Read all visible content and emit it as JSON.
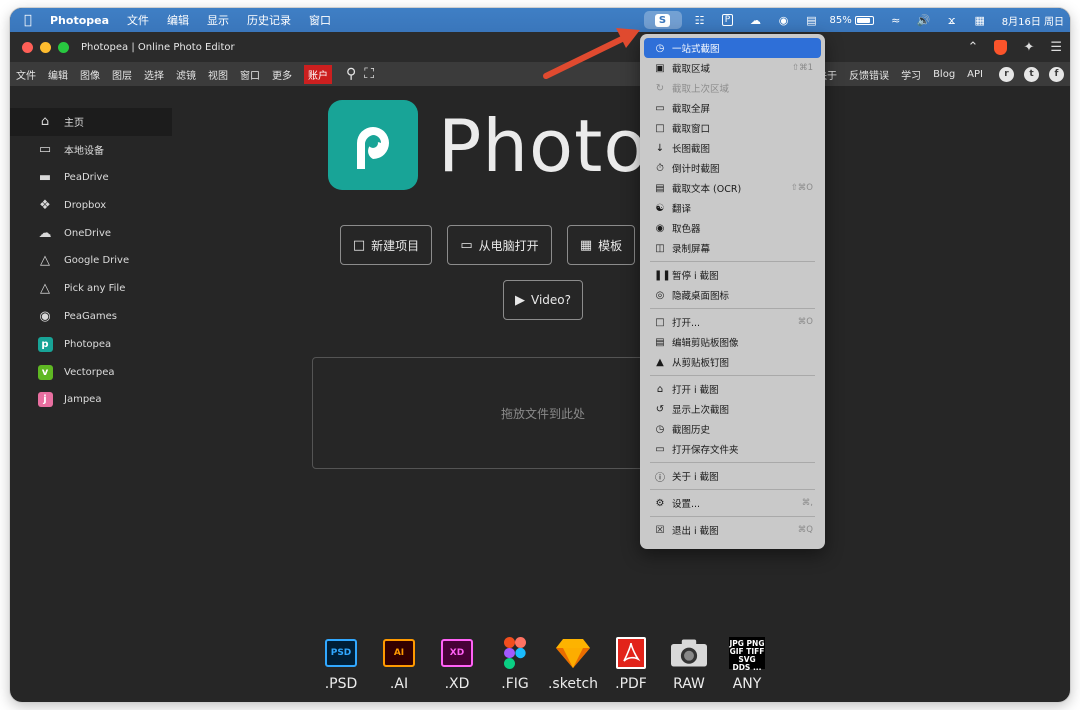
{
  "menubar": {
    "app_name": "Photopea",
    "menus": [
      "文件",
      "编辑",
      "显示",
      "历史记录",
      "窗口"
    ],
    "ishot_glyph": "S",
    "battery": "85%",
    "datetime": "8月16日 周日"
  },
  "browser": {
    "tab_title": "Photopea | Online Photo Editor"
  },
  "photopea_menu": {
    "left": [
      "文件",
      "编辑",
      "图像",
      "图层",
      "选择",
      "滤镜",
      "视图",
      "窗口",
      "更多"
    ],
    "account": "账户",
    "right": [
      "关于",
      "反馈错误",
      "学习",
      "Blog",
      "API"
    ]
  },
  "sidebar": {
    "items": [
      {
        "label": "主页",
        "icon": "home-icon"
      },
      {
        "label": "本地设备",
        "icon": "monitor-icon"
      },
      {
        "label": "PeaDrive",
        "icon": "drive-icon"
      },
      {
        "label": "Dropbox",
        "icon": "dropbox-icon"
      },
      {
        "label": "OneDrive",
        "icon": "cloud-icon"
      },
      {
        "label": "Google Drive",
        "icon": "google-drive-icon"
      },
      {
        "label": "Pick any File",
        "icon": "google-drive-icon"
      },
      {
        "label": "PeaGames",
        "icon": "gamepad-icon"
      },
      {
        "label": "Photopea",
        "icon": "photopea-icon"
      },
      {
        "label": "Vectorpea",
        "icon": "vectorpea-icon"
      },
      {
        "label": "Jampea",
        "icon": "jampea-icon"
      }
    ]
  },
  "main": {
    "logo_text": "Photopea",
    "buttons": {
      "new_project": "新建项目",
      "open_computer": "从电脑打开",
      "templates": "模板",
      "video": "Video?"
    },
    "dropzone": "拖放文件到此处",
    "formats": [
      {
        "label": ".PSD",
        "badge": "PSD",
        "color": "#31a8ff"
      },
      {
        "label": ".AI",
        "badge": "AI",
        "color": "#ff9a00"
      },
      {
        "label": ".XD",
        "badge": "XD",
        "color": "#ff61f6"
      },
      {
        "label": ".FIG",
        "badge": "",
        "color": "#f24e1e"
      },
      {
        "label": ".sketch",
        "badge": "",
        "color": "#fdb300"
      },
      {
        "label": ".PDF",
        "badge": "",
        "color": "#e2231a"
      },
      {
        "label": "RAW",
        "badge": "",
        "color": "#d0d0d0"
      },
      {
        "label": "ANY",
        "badge": "JPG PNG GIF TIFF SVG DDS ...",
        "color": "#000000"
      }
    ]
  },
  "dropdown": {
    "items": [
      {
        "label": "一站式截图",
        "icon": "clock-icon",
        "shortcut": "",
        "state": "highlight"
      },
      {
        "label": "截取区域",
        "icon": "region-icon",
        "shortcut": "⇧⌘1",
        "state": ""
      },
      {
        "label": "截取上次区域",
        "icon": "refresh-icon",
        "shortcut": "",
        "state": "disabled"
      },
      {
        "label": "截取全屏",
        "icon": "monitor-icon",
        "shortcut": "",
        "state": ""
      },
      {
        "label": "截取窗口",
        "icon": "window-icon",
        "shortcut": "",
        "state": ""
      },
      {
        "label": "长图截图",
        "icon": "arrow-down-icon",
        "shortcut": "",
        "state": ""
      },
      {
        "label": "倒计时截图",
        "icon": "timer-icon",
        "shortcut": "",
        "state": ""
      },
      {
        "label": "截取文本 (OCR)",
        "icon": "ocr-icon",
        "shortcut": "⇧⌘O",
        "state": ""
      },
      {
        "label": "翻译",
        "icon": "translate-icon",
        "shortcut": "",
        "state": ""
      },
      {
        "label": "取色器",
        "icon": "palette-icon",
        "shortcut": "",
        "state": ""
      },
      {
        "label": "录制屏幕",
        "icon": "video-icon",
        "shortcut": "",
        "state": ""
      },
      {
        "sep": true
      },
      {
        "label": "暂停 i 截图",
        "icon": "pause-icon",
        "shortcut": "",
        "state": ""
      },
      {
        "label": "隐藏桌面图标",
        "icon": "eye-icon",
        "shortcut": "",
        "state": ""
      },
      {
        "sep": true
      },
      {
        "label": "打开...",
        "icon": "file-icon",
        "shortcut": "⌘O",
        "state": ""
      },
      {
        "label": "编辑剪贴板图像",
        "icon": "clipboard-icon",
        "shortcut": "",
        "state": ""
      },
      {
        "label": "从剪贴板钉图",
        "icon": "pin-icon",
        "shortcut": "",
        "state": ""
      },
      {
        "sep": true
      },
      {
        "label": "打开 i 截图",
        "icon": "home-icon",
        "shortcut": "",
        "state": ""
      },
      {
        "label": "显示上次截图",
        "icon": "rotate-icon",
        "shortcut": "",
        "state": ""
      },
      {
        "label": "截图历史",
        "icon": "history-icon",
        "shortcut": "",
        "state": ""
      },
      {
        "label": "打开保存文件夹",
        "icon": "folder-icon",
        "shortcut": "",
        "state": ""
      },
      {
        "sep": true
      },
      {
        "label": "关于 i 截图",
        "icon": "info-icon",
        "shortcut": "",
        "state": ""
      },
      {
        "sep": true
      },
      {
        "label": "设置...",
        "icon": "gear-icon",
        "shortcut": "⌘,",
        "state": ""
      },
      {
        "sep": true
      },
      {
        "label": "退出 i 截图",
        "icon": "quit-icon",
        "shortcut": "⌘Q",
        "state": ""
      }
    ]
  },
  "colors": {
    "accent_blue": "#2e6fd8",
    "photopea_teal": "#18a497",
    "account_red": "#cc1f1f",
    "arrow_red": "#e04a2f"
  }
}
